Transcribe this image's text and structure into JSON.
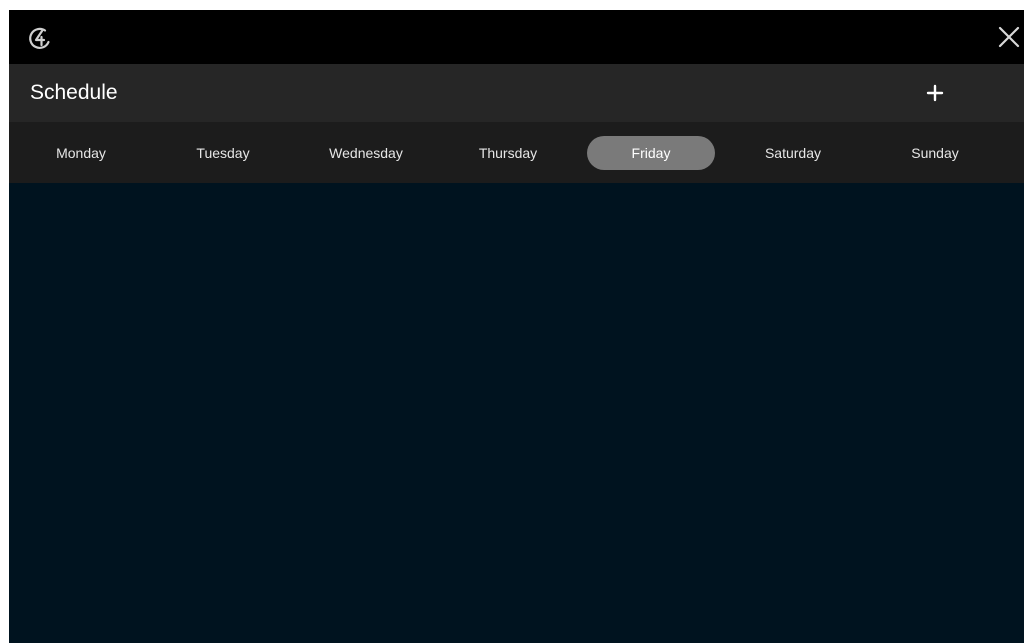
{
  "window": {
    "logo_icon": "app-logo-icon",
    "close_icon": "close-icon"
  },
  "header": {
    "title": "Schedule",
    "add_icon": "plus-icon"
  },
  "days": [
    {
      "label": "Monday",
      "selected": false
    },
    {
      "label": "Tuesday",
      "selected": false
    },
    {
      "label": "Wednesday",
      "selected": false
    },
    {
      "label": "Thursday",
      "selected": false
    },
    {
      "label": "Friday",
      "selected": true
    },
    {
      "label": "Saturday",
      "selected": false
    },
    {
      "label": "Sunday",
      "selected": false
    }
  ],
  "colors": {
    "content_background": "#00131f",
    "header_background": "#262626",
    "daybar_background": "#1c1c1c",
    "selected_pill": "#7a7a7a"
  }
}
